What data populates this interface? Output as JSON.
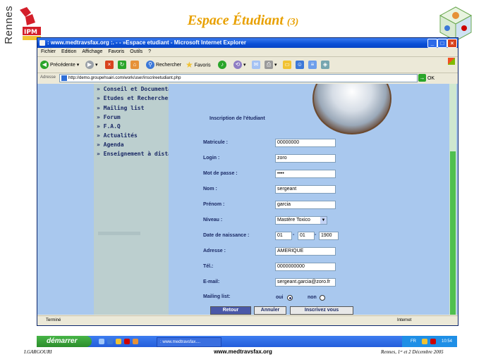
{
  "slide": {
    "side_text": "Rennes",
    "title": "Espace Étudiant",
    "title_num": "(3)",
    "footer_left": "I.GARGOURI",
    "footer_center": "www.medtravsfax.org",
    "footer_right": "Rennes, 1ᵉʳ et 2  Décembre 2005"
  },
  "window": {
    "title": ": www.medtravsfax.org :. - - »Espace etudiant - Microsoft Internet Explorer",
    "menu": [
      "Fichier",
      "Edition",
      "Affichage",
      "Favoris",
      "Outils",
      "?"
    ],
    "toolbar": {
      "back": "Précédente",
      "search": "Rechercher",
      "favorites": "Favoris"
    },
    "address_label": "Adresse",
    "address_value": "http://demo.groupehsairi.com/work/user/inscrireetudiant.php",
    "go_label": "OK",
    "status_left": "Terminé",
    "status_right": "Internet"
  },
  "nav": {
    "items": [
      "» Conseil et Documentation",
      "» Etudes et Recherches",
      "» Mailing list",
      "» Forum",
      "» F.A.Q",
      "» Actualités",
      "» Agenda",
      "» Enseignement à distance"
    ]
  },
  "form": {
    "title": "Inscription de l'étudiant",
    "matricule_label": "Matricule :",
    "matricule_value": "00000000",
    "login_label": "Login :",
    "login_value": "zoro",
    "password_label": "Mot de passe :",
    "password_value": "••••",
    "nom_label": "Nom :",
    "nom_value": "sergeant",
    "prenom_label": "Prénom :",
    "prenom_value": "garcia",
    "niveau_label": "Niveau :",
    "niveau_value": "Mastère Toxico",
    "naissance_label": "Date de naissance :",
    "naissance_day": "01",
    "naissance_month": "01",
    "naissance_year": "1900",
    "adresse_label": "Adresse :",
    "adresse_value": "AMERIQUE",
    "tel_label": "Tél.:",
    "tel_value": "0000000000",
    "email_label": "E-mail:",
    "email_value": "sergeant.garcia@zoro.fr",
    "mailing_label": "Mailing list:",
    "mailing_yes": "oui",
    "mailing_no": "non",
    "btn_retour": "Retour",
    "btn_annuler": "Annuler",
    "btn_inscrire": "Inscrivez vous"
  },
  "taskbar": {
    "start": "démarrer",
    "task": ": www.medtravsfax....",
    "lang": "FR",
    "clock": "10:54"
  },
  "colors": {
    "page_bg": "#a9c8ee",
    "nav_bg": "#bccfcf",
    "label_text": "#1b2a66",
    "title_orange": "#e8a000"
  }
}
